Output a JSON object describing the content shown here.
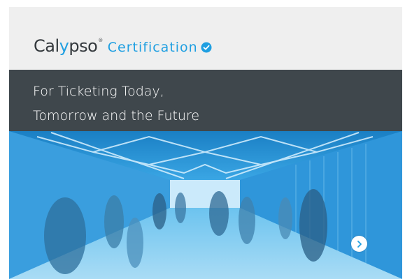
{
  "brand": {
    "logo_prefix": "Cal",
    "logo_y": "y",
    "logo_suffix": "pso",
    "logo_trademark": "®",
    "certification_label": "Certification",
    "certified_icon": "check-badge-icon"
  },
  "banner": {
    "line1": "For Ticketing Today,",
    "line2": "Tomorrow and the Future"
  },
  "hero": {
    "image_subject": "people-walking-in-corridor",
    "next_icon": "chevron-right-icon"
  },
  "colors": {
    "accent": "#1f9fe1",
    "banner_bg": "#3f474c",
    "card_bg": "#efefef",
    "logo_text": "#34393d"
  }
}
